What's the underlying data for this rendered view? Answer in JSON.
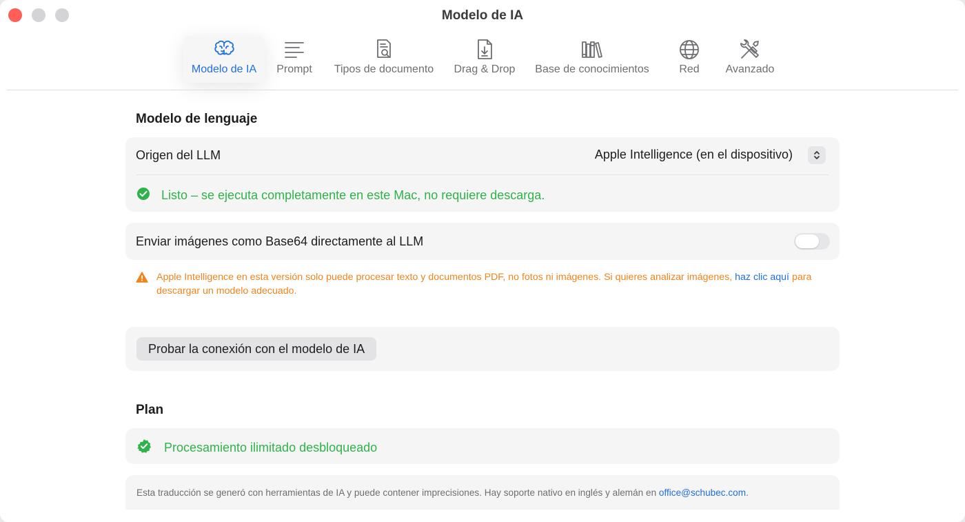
{
  "window": {
    "title": "Modelo de IA"
  },
  "tabs": [
    {
      "label": "Modelo de IA",
      "icon": "brain-icon",
      "active": true
    },
    {
      "label": "Prompt",
      "icon": "text-lines-icon"
    },
    {
      "label": "Tipos de documento",
      "icon": "document-search-icon"
    },
    {
      "label": "Drag & Drop",
      "icon": "document-download-icon"
    },
    {
      "label": "Base de conocimientos",
      "icon": "books-icon"
    },
    {
      "label": "Red",
      "icon": "globe-icon"
    },
    {
      "label": "Avanzado",
      "icon": "tools-icon"
    }
  ],
  "language_model": {
    "section_title": "Modelo de lenguaje",
    "llm_source_label": "Origen del LLM",
    "llm_source_value": "Apple Intelligence (en el dispositivo)",
    "ready_text": "Listo – se ejecuta completamente en este Mac, no requiere descarga.",
    "send_images_label": "Enviar imágenes como Base64 directamente al LLM",
    "send_images_enabled": false,
    "warning_text": "Apple Intelligence en esta versión solo puede procesar texto y documentos PDF, no fotos ni imágenes. Si quieres analizar imágenes, ",
    "warning_link": "haz clic aquí",
    "warning_suffix": " para descargar un modelo adecuado.",
    "test_button": "Probar la conexión con el modelo de IA"
  },
  "plan": {
    "section_title": "Plan",
    "status": "Procesamiento ilimitado desbloqueado"
  },
  "footer_note": {
    "text": "Esta traducción se generó con herramientas de IA y puede contener imprecisiones. Hay soporte nativo en inglés y alemán en ",
    "email": "office@schubec.com",
    "suffix": "."
  },
  "colors": {
    "accent": "#1f6fe0",
    "success": "#2eb34a",
    "warning": "#f0841c"
  }
}
